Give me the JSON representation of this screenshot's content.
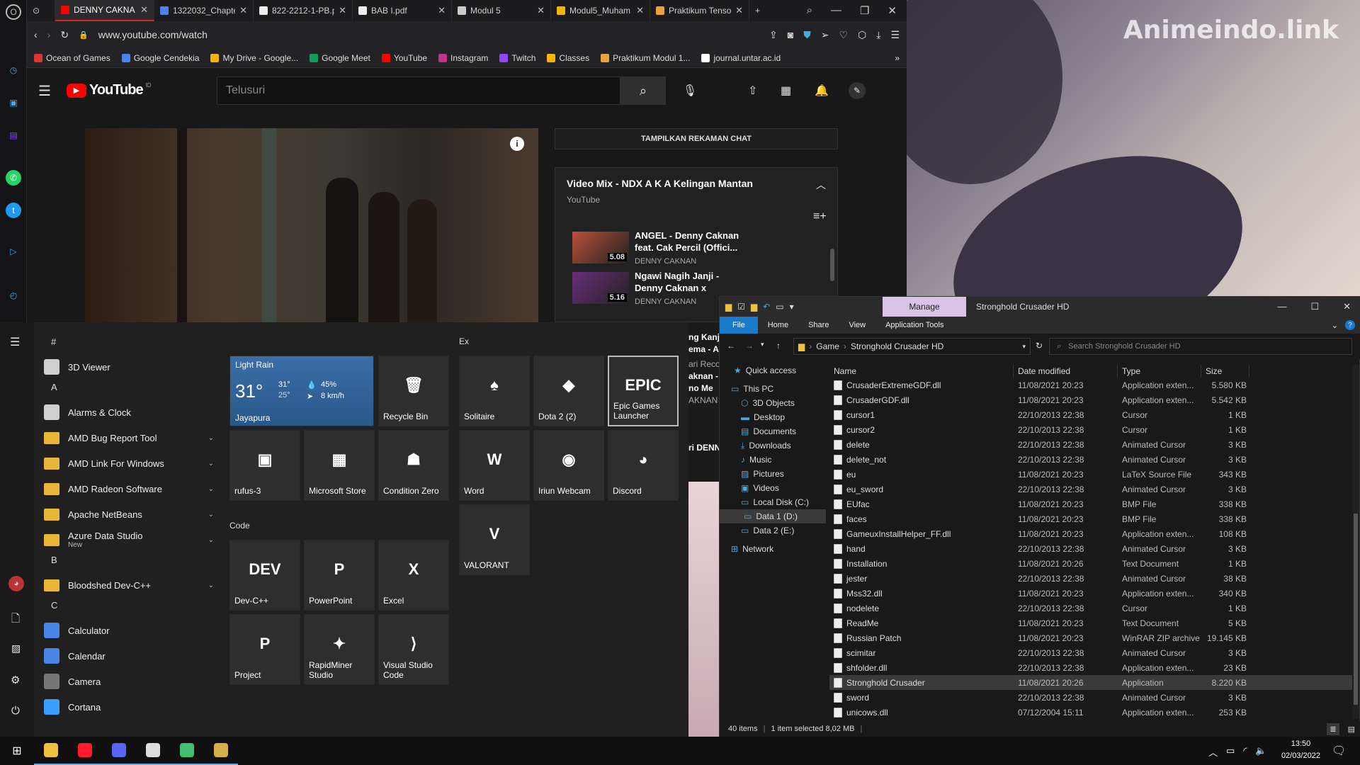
{
  "browser": {
    "tabs": [
      {
        "label": "DENNY CAKNA",
        "color": "#ff0000"
      },
      {
        "label": "1322032_Chapte",
        "color": "#4a86e8"
      },
      {
        "label": "822-2212-1-PB.p",
        "color": "#eeeeee"
      },
      {
        "label": "BAB I.pdf",
        "color": "#eeeeee"
      },
      {
        "label": "Modul 5",
        "color": "#cccccc"
      },
      {
        "label": "Modul5_Muham",
        "color": "#f4b400"
      },
      {
        "label": "Praktikum Tenso",
        "color": "#e8a33c"
      }
    ],
    "url": "www.youtube.com/watch",
    "bookmarks": [
      {
        "label": "Ocean of Games",
        "color": "#d33"
      },
      {
        "label": "Google Cendekia",
        "color": "#4a86e8"
      },
      {
        "label": "My Drive - Google...",
        "color": "#f4b400"
      },
      {
        "label": "Google Meet",
        "color": "#0f9d58"
      },
      {
        "label": "YouTube",
        "color": "#ff0000"
      },
      {
        "label": "Instagram",
        "color": "#c13584"
      },
      {
        "label": "Twitch",
        "color": "#9146ff"
      },
      {
        "label": "Classes",
        "color": "#f4b400"
      },
      {
        "label": "Praktikum Modul 1...",
        "color": "#e8a33c"
      },
      {
        "label": "journal.untar.ac.id",
        "color": "#ffffff"
      }
    ]
  },
  "youtube": {
    "logo": "YouTube",
    "region": "ID",
    "search_placeholder": "Telusuri",
    "chat_button": "TAMPILKAN REKAMAN CHAT",
    "playlist": {
      "title": "Video Mix - NDX A K A Kelingan Mantan",
      "channel": "YouTube",
      "items": [
        {
          "title": "ANGEL - Denny Caknan feat. Cak Percil (Offici...",
          "channel": "DENNY CAKNAN",
          "duration": "5.08",
          "thumb": "#b8503a"
        },
        {
          "title": "Ngawi Nagih Janji - Denny Caknan x",
          "channel": "DENNY CAKNAN",
          "duration": "5.16",
          "thumb": "#6a2e7a"
        }
      ]
    },
    "behind_fragments": [
      "ng Kanj",
      "ema - A",
      "ari Reco",
      "aknan -",
      "no Me",
      "AKNAN",
      "ri DENN"
    ]
  },
  "start_menu": {
    "apps": [
      {
        "type": "letter",
        "label": "#"
      },
      {
        "type": "app",
        "label": "3D Viewer",
        "icon": "cube-icon",
        "color": "#cfcfcf"
      },
      {
        "type": "letter",
        "label": "A"
      },
      {
        "type": "app",
        "label": "Alarms & Clock",
        "icon": "clock-icon",
        "color": "#cfcfcf"
      },
      {
        "type": "folder",
        "label": "AMD Bug Report Tool"
      },
      {
        "type": "folder",
        "label": "AMD Link For Windows"
      },
      {
        "type": "folder",
        "label": "AMD Radeon Software"
      },
      {
        "type": "folder",
        "label": "Apache NetBeans"
      },
      {
        "type": "folder",
        "label": "Azure Data Studio",
        "sub": "New"
      },
      {
        "type": "letter",
        "label": "B"
      },
      {
        "type": "folder",
        "label": "Bloodshed Dev-C++"
      },
      {
        "type": "letter",
        "label": "C"
      },
      {
        "type": "app",
        "label": "Calculator",
        "icon": "calculator-icon",
        "color": "#4a86e8"
      },
      {
        "type": "app",
        "label": "Calendar",
        "icon": "calendar-icon",
        "color": "#4a86e8"
      },
      {
        "type": "app",
        "label": "Camera",
        "icon": "camera-icon",
        "color": "#777777"
      },
      {
        "type": "app",
        "label": "Cortana",
        "icon": "cortana-icon",
        "color": "#3aa0ff"
      }
    ],
    "weather": {
      "condition": "Light Rain",
      "temp": "31°",
      "high": "31°",
      "low": "25°",
      "humidity": "45%",
      "wind": "8 km/h",
      "city": "Jayapura"
    },
    "groups": {
      "ex": "Ex",
      "code": "Code"
    },
    "tiles": [
      {
        "label": "Recycle Bin",
        "glyph": "🗑",
        "color": "#2e2e2e"
      },
      {
        "label": "rufus-3",
        "glyph": "▣",
        "color": "#2e2e2e"
      },
      {
        "label": "Microsoft Store",
        "glyph": "▦",
        "color": "#2e2e2e"
      },
      {
        "label": "Condition Zero",
        "glyph": "☗",
        "color": "#2e2e2e"
      },
      {
        "label": "Solitaire",
        "glyph": "♠",
        "color": "#2e2e2e"
      },
      {
        "label": "Dota 2 (2)",
        "glyph": "◆",
        "color": "#2e2e2e"
      },
      {
        "label": "Epic Games Launcher",
        "glyph": "EPIC",
        "color": "#2e2e2e"
      },
      {
        "label": "Word",
        "glyph": "W",
        "color": "#2e2e2e"
      },
      {
        "label": "Iriun Webcam",
        "glyph": "◉",
        "color": "#2e2e2e"
      },
      {
        "label": "Discord",
        "glyph": "◕",
        "color": "#2e2e2e"
      },
      {
        "label": "VALORANT",
        "glyph": "V",
        "color": "#2e2e2e"
      },
      {
        "label": "Dev-C++",
        "glyph": "DEV",
        "color": "#2e2e2e"
      },
      {
        "label": "PowerPoint",
        "glyph": "P",
        "color": "#2e2e2e"
      },
      {
        "label": "Excel",
        "glyph": "X",
        "color": "#2e2e2e"
      },
      {
        "label": "Project",
        "glyph": "P",
        "color": "#2e2e2e"
      },
      {
        "label": "RapidMiner Studio",
        "glyph": "✦",
        "color": "#2e2e2e"
      },
      {
        "label": "Visual Studio Code",
        "glyph": "⟩",
        "color": "#2e2e2e"
      }
    ]
  },
  "explorer": {
    "manage_tab": "Manage",
    "title": "Stronghold Crusader HD",
    "ribbon": [
      "File",
      "Home",
      "Share",
      "View",
      "Application Tools"
    ],
    "path": [
      "Game",
      "Stronghold Crusader HD"
    ],
    "search_placeholder": "Search Stronghold Crusader HD",
    "nav": [
      {
        "label": "Quick access",
        "icon": "star-icon"
      },
      {
        "label": "This PC",
        "icon": "pc-icon"
      },
      {
        "label": "3D Objects",
        "icon": "cube-icon"
      },
      {
        "label": "Desktop",
        "icon": "desktop-icon"
      },
      {
        "label": "Documents",
        "icon": "documents-icon"
      },
      {
        "label": "Downloads",
        "icon": "download-icon"
      },
      {
        "label": "Music",
        "icon": "music-icon"
      },
      {
        "label": "Pictures",
        "icon": "pictures-icon"
      },
      {
        "label": "Videos",
        "icon": "videos-icon"
      },
      {
        "label": "Local Disk (C:)",
        "icon": "disk-icon"
      },
      {
        "label": "Data 1 (D:)",
        "icon": "disk-icon"
      },
      {
        "label": "Data 2 (E:)",
        "icon": "disk-icon"
      },
      {
        "label": "Network",
        "icon": "network-icon"
      }
    ],
    "columns": [
      "Name",
      "Date modified",
      "Type",
      "Size"
    ],
    "files": [
      [
        "CrusaderExtremeGDF.dll",
        "11/08/2021 20:23",
        "Application exten...",
        "5.580 KB"
      ],
      [
        "CrusaderGDF.dll",
        "11/08/2021 20:23",
        "Application exten...",
        "5.542 KB"
      ],
      [
        "cursor1",
        "22/10/2013 22:38",
        "Cursor",
        "1 KB"
      ],
      [
        "cursor2",
        "22/10/2013 22:38",
        "Cursor",
        "1 KB"
      ],
      [
        "delete",
        "22/10/2013 22:38",
        "Animated Cursor",
        "3 KB"
      ],
      [
        "delete_not",
        "22/10/2013 22:38",
        "Animated Cursor",
        "3 KB"
      ],
      [
        "eu",
        "11/08/2021 20:23",
        "LaTeX Source File",
        "343 KB"
      ],
      [
        "eu_sword",
        "22/10/2013 22:38",
        "Animated Cursor",
        "3 KB"
      ],
      [
        "EUfac",
        "11/08/2021 20:23",
        "BMP File",
        "338 KB"
      ],
      [
        "faces",
        "11/08/2021 20:23",
        "BMP File",
        "338 KB"
      ],
      [
        "GameuxInstallHelper_FF.dll",
        "11/08/2021 20:23",
        "Application exten...",
        "108 KB"
      ],
      [
        "hand",
        "22/10/2013 22:38",
        "Animated Cursor",
        "3 KB"
      ],
      [
        "Installation",
        "11/08/2021 20:26",
        "Text Document",
        "1 KB"
      ],
      [
        "jester",
        "22/10/2013 22:38",
        "Animated Cursor",
        "38 KB"
      ],
      [
        "Mss32.dll",
        "11/08/2021 20:23",
        "Application exten...",
        "340 KB"
      ],
      [
        "nodelete",
        "22/10/2013 22:38",
        "Cursor",
        "1 KB"
      ],
      [
        "ReadMe",
        "11/08/2021 20:23",
        "Text Document",
        "5 KB"
      ],
      [
        "Russian Patch",
        "11/08/2021 20:23",
        "WinRAR ZIP archive",
        "19.145 KB"
      ],
      [
        "scimitar",
        "22/10/2013 22:38",
        "Animated Cursor",
        "3 KB"
      ],
      [
        "shfolder.dll",
        "22/10/2013 22:38",
        "Application exten...",
        "23 KB"
      ],
      [
        "Stronghold Crusader",
        "11/08/2021 20:26",
        "Application",
        "8.220 KB"
      ],
      [
        "sword",
        "22/10/2013 22:38",
        "Animated Cursor",
        "3 KB"
      ],
      [
        "unicows.dll",
        "07/12/2004 15:11",
        "Application exten...",
        "253 KB"
      ]
    ],
    "selected_index": 20,
    "status": {
      "items": "40 items",
      "selected": "1 item selected  8,02 MB"
    }
  },
  "wallpaper": {
    "watermark": "Animeindo.link"
  },
  "taskbar": {
    "time": "13:50",
    "date": "02/03/2022",
    "apps": [
      {
        "icon": "explorer-icon",
        "color": "#f0c040"
      },
      {
        "icon": "opera-icon",
        "color": "#ff1b2d"
      },
      {
        "icon": "discord-icon",
        "color": "#5865f2"
      },
      {
        "icon": "epic-icon",
        "color": "#dddddd"
      },
      {
        "icon": "python-icon",
        "color": "#3fbf6f"
      },
      {
        "icon": "stronghold-icon",
        "color": "#d4b04a"
      }
    ]
  }
}
